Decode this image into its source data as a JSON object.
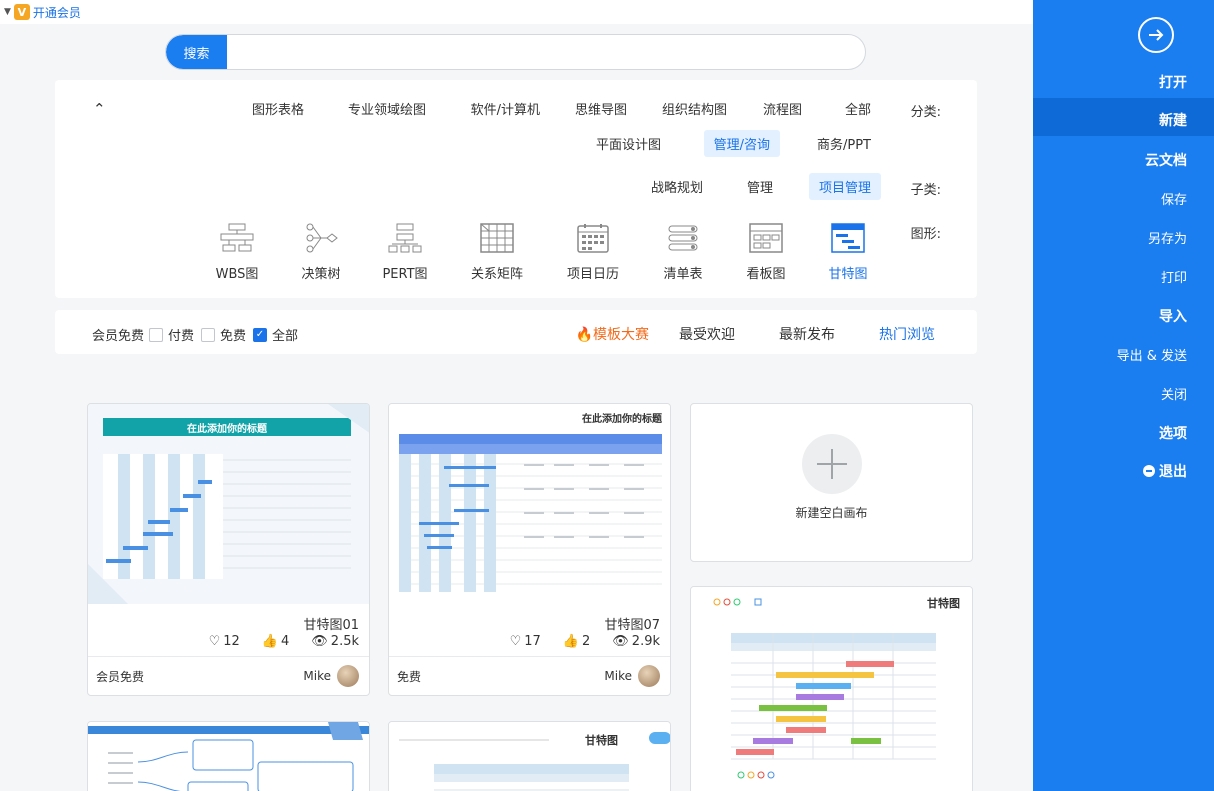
{
  "vip": {
    "label": "开通会员",
    "badge": "V"
  },
  "search": {
    "button": "搜索",
    "placeholder": ""
  },
  "category": {
    "label": "分类:",
    "options": [
      "全部",
      "流程图",
      "组织结构图",
      "思维导图",
      "软件/计算机",
      "专业领域绘图",
      "图形表格",
      "商务/PPT",
      "管理/咨询",
      "平面设计图"
    ],
    "active": "管理/咨询"
  },
  "subcategory": {
    "label": "子类:",
    "options": [
      "项目管理",
      "管理",
      "战略规划"
    ],
    "active": "项目管理"
  },
  "figure": {
    "label": "图形:",
    "types": [
      {
        "label": "甘特图",
        "icon": "gantt-chart-icon",
        "active": true
      },
      {
        "label": "看板图",
        "icon": "kanban-icon",
        "active": false
      },
      {
        "label": "清单表",
        "icon": "checklist-icon",
        "active": false
      },
      {
        "label": "项目日历",
        "icon": "calendar-icon",
        "active": false
      },
      {
        "label": "关系矩阵",
        "icon": "matrix-icon",
        "active": false
      },
      {
        "label": "PERT图",
        "icon": "pert-icon",
        "active": false
      },
      {
        "label": "决策树",
        "icon": "decision-tree-icon",
        "active": false
      },
      {
        "label": "WBS图",
        "icon": "wbs-icon",
        "active": false
      }
    ]
  },
  "filter": {
    "tabs": [
      "热门浏览",
      "最新发布",
      "最受欢迎",
      "模板大赛"
    ],
    "active_tab": "热门浏览",
    "checkboxes": [
      {
        "label": "全部",
        "checked": true
      },
      {
        "label": "免费",
        "checked": false
      },
      {
        "label": "付费",
        "checked": false
      },
      {
        "label": "会员免费",
        "checked": false
      }
    ]
  },
  "new_blank": {
    "label": "新建空白画布"
  },
  "cards": [
    {
      "title": "甘特图07",
      "views": "2.9k",
      "likes": "2",
      "favorites": "17",
      "author": "Mike",
      "price": "免费"
    },
    {
      "title": "甘特图01",
      "views": "2.5k",
      "likes": "4",
      "favorites": "12",
      "author": "Mike",
      "price": "会员免费"
    },
    {
      "title": "甘特图",
      "views": "",
      "likes": "",
      "favorites": "",
      "author": "",
      "price": ""
    }
  ],
  "preview_texts": {
    "card1_title": "在此添加你的标题",
    "card0_title": "在此添加你的标题",
    "card2_title": "甘特图",
    "card3_title": "甘特图"
  },
  "sidebar": {
    "items": [
      "打开",
      "新建",
      "云文档",
      "保存",
      "另存为",
      "打印",
      "导入",
      "导出 & 发送",
      "关闭",
      "选项",
      "退出"
    ],
    "active": "新建"
  },
  "colors": {
    "accent": "#1a7df0",
    "hot": "#f26b1d"
  }
}
